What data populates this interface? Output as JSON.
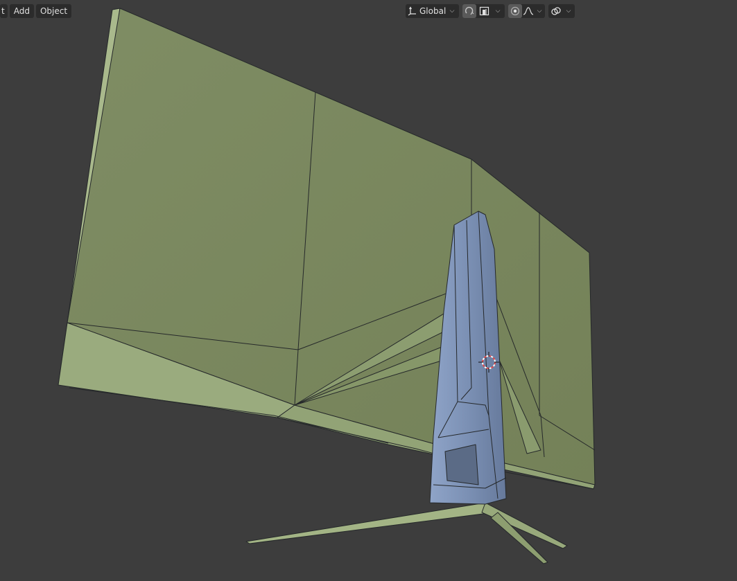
{
  "menu": {
    "edit_label": "t",
    "add_label": "Add",
    "object_label": "Object"
  },
  "header": {
    "orientation_label": "Global",
    "icons": [
      "transform-orientation-icon",
      "chevron-down-icon",
      "snap-icon",
      "snap-target-icon",
      "proportional-edit-icon",
      "falloff-curve-icon",
      "overlay-link-icon"
    ]
  },
  "colors": {
    "background": "#3d3d3d",
    "header_button": "#2b2b2b",
    "monitor_face": "#7c8962",
    "monitor_edge": "#a9b98d",
    "stand": "#7e93b6",
    "wire": "#25282a"
  }
}
